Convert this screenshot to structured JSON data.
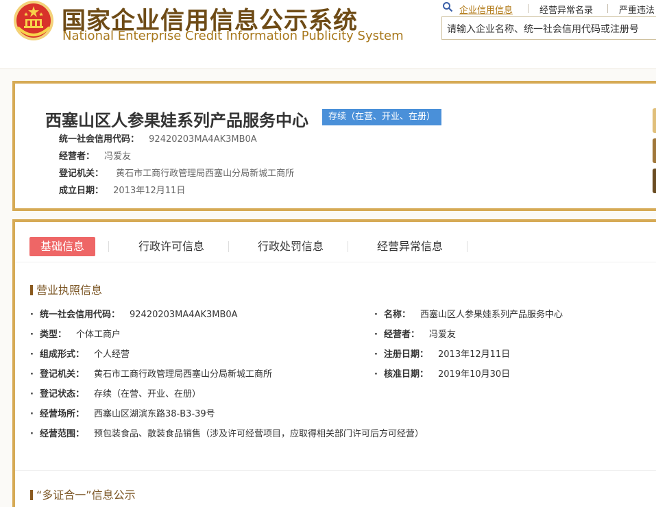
{
  "header": {
    "title_cn": "国家企业信用信息公示系统",
    "title_en": "National Enterprise Credit Information Publicity System",
    "nav": [
      "企业信用信息",
      "经营异常名录",
      "严重违法"
    ],
    "search_placeholder": "请输入企业名称、统一社会信用代码或注册号"
  },
  "company": {
    "name": "西塞山区人参果娃系列产品服务中心",
    "status": "存续（在营、开业、在册）",
    "summary": [
      {
        "label": "统一社会信用代码：",
        "value": "92420203MA4AK3MB0A"
      },
      {
        "label": "经营者：",
        "value": "冯爱友"
      },
      {
        "label": "登记机关：",
        "value": "黄石市工商行政管理局西塞山分局新城工商所"
      },
      {
        "label": "成立日期：",
        "value": "2013年12月11日"
      }
    ]
  },
  "tabs": [
    "基础信息",
    "行政许可信息",
    "行政处罚信息",
    "经营异常信息"
  ],
  "license": {
    "title": "营业执照信息",
    "left": [
      {
        "label": "统一社会信用代码：",
        "value": "92420203MA4AK3MB0A"
      },
      {
        "label": "类型：",
        "value": "个体工商户"
      },
      {
        "label": "组成形式：",
        "value": "个人经营"
      },
      {
        "label": "登记机关：",
        "value": "黄石市工商行政管理局西塞山分局新城工商所"
      },
      {
        "label": "登记状态：",
        "value": "存续（在营、开业、在册）"
      },
      {
        "label": "经营场所：",
        "value": "西塞山区湖滨东路38-B3-39号"
      },
      {
        "label": "经营范围：",
        "value": "预包装食品、散装食品销售（涉及许可经营项目，应取得相关部门许可后方可经营）"
      }
    ],
    "right": [
      {
        "label": "名称：",
        "value": "西塞山区人参果娃系列产品服务中心"
      },
      {
        "label": "经营者：",
        "value": "冯爱友"
      },
      {
        "label": "注册日期：",
        "value": "2013年12月11日"
      },
      {
        "label": "核准日期：",
        "value": "2019年10月30日"
      }
    ]
  },
  "section2_title": "“多证合一”信息公示",
  "colors": {
    "gold_border": "#d6aa55",
    "badge_blue": "#4a90d9",
    "tab_active": "#ee6666",
    "brown": "#6e4b16"
  }
}
